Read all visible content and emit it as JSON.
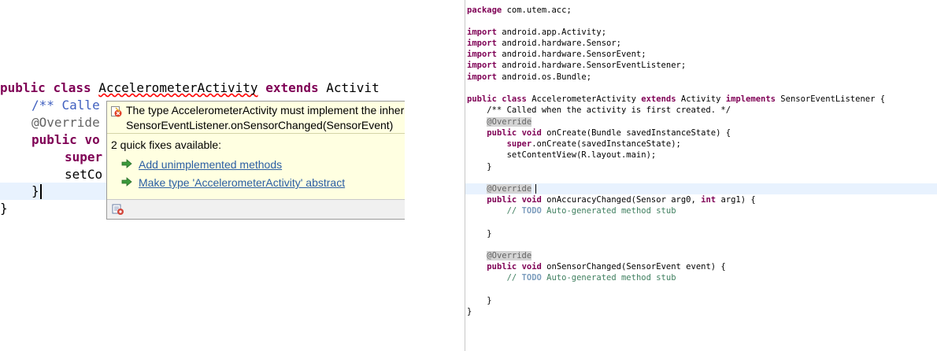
{
  "left_editor": {
    "line1": {
      "kw1": "public",
      "kw2": "class",
      "class_name": "AccelerometerActivity",
      "kw3": "extends",
      "parent": "Activit"
    },
    "line2": "/** Calle",
    "line3": "@Override",
    "line4": {
      "kw": "public",
      "rest": "vo"
    },
    "line5": {
      "kw": "super"
    },
    "line6": "setCo",
    "line7": "}",
    "line8": "}"
  },
  "popup": {
    "message_line1": "The type AccelerometerActivity must implement the inher",
    "message_line2": "SensorEventListener.onSensorChanged(SensorEvent)",
    "fix_count": "2 quick fixes available:",
    "fixes": [
      "Add unimplemented methods",
      "Make type 'AccelerometerActivity' abstract"
    ],
    "error_icon": "error-icon",
    "fix_icon": "quickfix-icon",
    "footer_icon": "settings-icon"
  },
  "right_editor": {
    "package_kw": "package",
    "package_name": " com.utem.acc;",
    "imports": [
      " android.app.Activity;",
      " android.hardware.Sensor;",
      " android.hardware.SensorEvent;",
      " android.hardware.SensorEventListener;",
      " android.os.Bundle;"
    ],
    "import_kw": "import",
    "class_decl": {
      "public": "public",
      "class": "class",
      "name": " AccelerometerActivity ",
      "extends": "extends",
      "parent": " Activity ",
      "implements": "implements",
      "iface": " SensorEventListener {"
    },
    "javadoc": "    /** Called when the activity is first created. */",
    "override": "@Override",
    "oncreate": {
      "public": "public",
      "void": "void",
      "sig": " onCreate(Bundle savedInstanceState) {"
    },
    "super_call": {
      "super": "super",
      "rest": ".onCreate(savedInstanceState);"
    },
    "setcontent": "        setContentView(R.layout.main);",
    "close_method": "    }",
    "onaccuracy": {
      "public": "public",
      "void": "void",
      "sig1": " onAccuracyChanged(Sensor arg0, ",
      "int": "int",
      "sig2": " arg1) {"
    },
    "todo_kw": "TODO",
    "todo_text": " Auto-generated method stub",
    "onsensor": {
      "public": "public",
      "void": "void",
      "sig": " onSensorChanged(SensorEvent event) {"
    },
    "close_class": "}"
  },
  "colors": {
    "keyword": "#7f0055",
    "javadoc": "#3f5fbf",
    "comment": "#3f7f5f",
    "annotation": "#646464",
    "popup_bg": "#ffffe1",
    "link": "#2b5ea3"
  }
}
